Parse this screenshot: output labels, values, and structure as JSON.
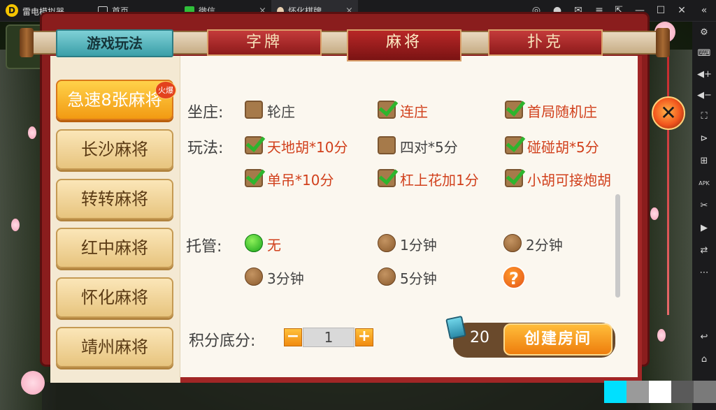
{
  "titlebar": {
    "app_name": "雷电模拟器",
    "tabs": [
      {
        "label": "首页"
      },
      {
        "label": "微信"
      },
      {
        "label": "怀化棋牌"
      }
    ],
    "tab_close": "×"
  },
  "sidebar": {
    "icons": [
      "settings-icon",
      "keyboard-icon",
      "volume-up-icon",
      "volume-down-icon",
      "fullscreen-icon",
      "record-icon",
      "add-app-icon",
      "apk-icon",
      "scissors-icon",
      "video-icon",
      "sync-icon",
      "more-icon",
      "back-icon",
      "home-icon"
    ],
    "apk_label": "APK"
  },
  "panel": {
    "rules_tab": "游戏玩法",
    "categories": [
      {
        "label": "字牌",
        "active": false
      },
      {
        "label": "麻将",
        "active": true
      },
      {
        "label": "扑克",
        "active": false
      }
    ],
    "games": [
      {
        "label": "急速8张麻将",
        "active": true
      },
      {
        "label": "长沙麻将",
        "active": false
      },
      {
        "label": "转转麻将",
        "active": false
      },
      {
        "label": "红中麻将",
        "active": false
      },
      {
        "label": "怀化麻将",
        "active": false
      },
      {
        "label": "靖州麻将",
        "active": false
      }
    ],
    "hot_badge": "火爆",
    "dealer": {
      "label": "坐庄:",
      "options": [
        {
          "text": "轮庄",
          "checked": false
        },
        {
          "text": "连庄",
          "checked": true
        },
        {
          "text": "首局随机庄",
          "checked": true
        }
      ]
    },
    "play": {
      "label": "玩法:",
      "options": [
        {
          "text": "天地胡*10分",
          "checked": true
        },
        {
          "text": "四对*5分",
          "checked": false
        },
        {
          "text": "碰碰胡*5分",
          "checked": true
        },
        {
          "text": "单吊*10分",
          "checked": true
        },
        {
          "text": "杠上花加1分",
          "checked": true
        },
        {
          "text": "小胡可接炮胡",
          "checked": true
        }
      ]
    },
    "auto": {
      "label": "托管:",
      "options": [
        {
          "text": "无",
          "selected": true
        },
        {
          "text": "1分钟",
          "selected": false
        },
        {
          "text": "2分钟",
          "selected": false
        },
        {
          "text": "3分钟",
          "selected": false
        },
        {
          "text": "5分钟",
          "selected": false
        }
      ],
      "help": "?"
    },
    "score": {
      "label": "积分底分:",
      "minus": "−",
      "value": "1",
      "plus": "+"
    },
    "room_cards": "20",
    "create_button": "创建房间",
    "close_icon": "✕"
  },
  "colors": {
    "accent": "#f29a12",
    "checked_text": "#d1401c",
    "check_mark": "#2db52d",
    "panel_red": "#a12626"
  }
}
